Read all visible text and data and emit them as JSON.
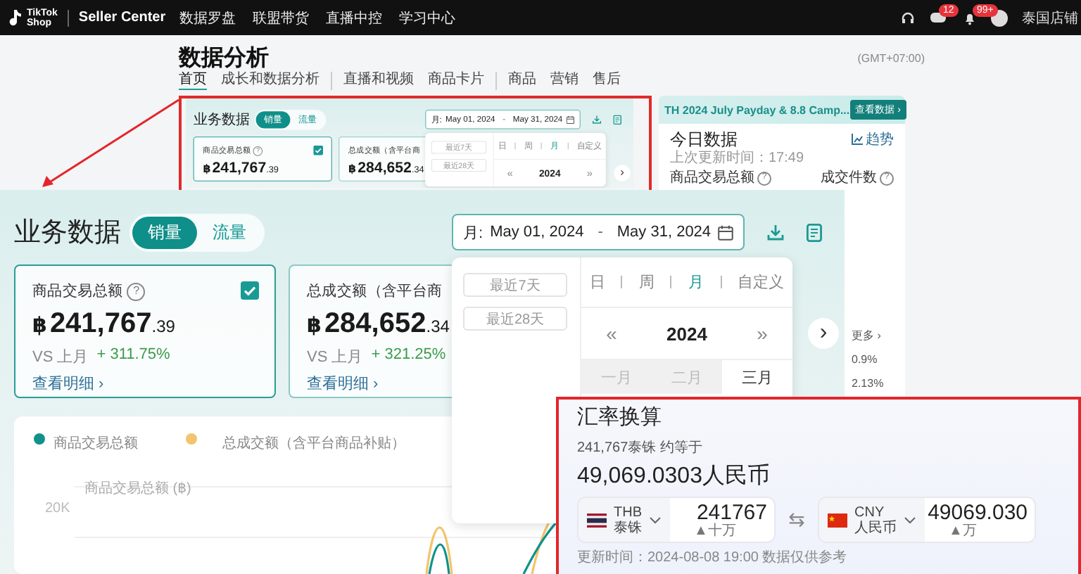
{
  "top_bar": {
    "logo_top": "TikTok",
    "logo_bottom": "Shop",
    "product": "Seller Center",
    "nav": [
      {
        "label": "数据罗盘"
      },
      {
        "label": "联盟带货"
      },
      {
        "label": "直播中控"
      },
      {
        "label": "学习中心"
      }
    ],
    "message_badge": "12",
    "notification_badge": "99+",
    "user": "泰国店铺"
  },
  "page": {
    "title": "数据分析",
    "timezone": "(GMT+07:00)",
    "tab_groups": [
      [
        {
          "label": "首页",
          "selected": true
        },
        {
          "label": "成长和数据分析",
          "selected": false
        }
      ],
      [
        {
          "label": "直播和视频",
          "selected": false
        },
        {
          "label": "商品卡片",
          "selected": false
        }
      ],
      [
        {
          "label": "商品",
          "selected": false
        },
        {
          "label": "营销",
          "selected": false
        },
        {
          "label": "售后",
          "selected": false
        }
      ]
    ]
  },
  "business_panel_preview": {
    "title": "业务数据",
    "toggle": [
      {
        "label": "销量",
        "selected": true
      },
      {
        "label": "流量",
        "selected": false
      }
    ],
    "date_range": {
      "prefix": "月:",
      "start": "May 01, 2024",
      "separator": "-",
      "end": "May 31, 2024"
    },
    "cards": [
      {
        "label": "商品交易总额",
        "help": "?",
        "checked": true,
        "currency": "฿",
        "value": "241,767",
        "decimals": ".39"
      },
      {
        "label": "总成交额（含平台商",
        "checked": false,
        "currency": "฿",
        "value": "284,652",
        "decimals": ".34"
      }
    ],
    "next": "›",
    "dropdown": {
      "quick": [
        "最近7天",
        "最近28天"
      ],
      "modes": [
        {
          "label": "日",
          "selected": false
        },
        {
          "label": "周",
          "selected": false
        },
        {
          "label": "月",
          "selected": true
        },
        {
          "label": "自定义",
          "selected": false
        }
      ],
      "prev": "«",
      "year": "2024",
      "next": "»"
    }
  },
  "today_card": {
    "banner": "TH 2024 July Payday & 8.8 Camp...",
    "banner_button": "查看数据 ›",
    "title": "今日数据",
    "trend": "趋势",
    "updated": "上次更新时间：17:49",
    "metrics": [
      {
        "label": "商品交易总额",
        "help": "?"
      },
      {
        "label": "成交件数",
        "help": "?"
      }
    ],
    "more": "更多 ›",
    "values": [
      "0.9%",
      "2.13%"
    ]
  },
  "business_panel_zoomed": {
    "title": "业务数据",
    "toggle": [
      {
        "label": "销量",
        "selected": true
      },
      {
        "label": "流量",
        "selected": false
      }
    ],
    "date_range": {
      "prefix": "月:",
      "start": "May 01, 2024",
      "separator": "-",
      "end": "May 31, 2024"
    },
    "cards": [
      {
        "label": "商品交易总额",
        "help": "?",
        "checked": true,
        "currency": "฿",
        "value": "241,767",
        "decimals": ".39",
        "compare": "VS 上月",
        "change": "+ 311.75%",
        "link": "查看明细 ›"
      },
      {
        "label": "总成交额（含平台商",
        "checked": false,
        "currency": "฿",
        "value": "284,652",
        "decimals": ".34",
        "compare": "VS 上月",
        "change": "+ 321.25%",
        "link": "查看明细 ›"
      }
    ],
    "next": "›",
    "dropdown": {
      "quick": [
        "最近7天",
        "最近28天"
      ],
      "modes": [
        {
          "label": "日",
          "selected": false
        },
        {
          "label": "周",
          "selected": false
        },
        {
          "label": "月",
          "selected": true
        },
        {
          "label": "自定义",
          "selected": false
        }
      ],
      "prev": "«",
      "year": "2024",
      "next": "»",
      "months": [
        {
          "label": "一月",
          "disabled": true
        },
        {
          "label": "二月",
          "disabled": true
        },
        {
          "label": "三月",
          "disabled": false
        }
      ]
    },
    "chart": {
      "legend": [
        {
          "label": "商品交易总额",
          "color": "#12918b"
        },
        {
          "label": "总成交额（含平台商品补贴）",
          "color": "#f2c46d"
        }
      ],
      "axis_title": "商品交易总额 (฿)",
      "y_labels": [
        "20K"
      ]
    }
  },
  "exchange": {
    "title": "汇率换算",
    "summary": "241,767泰铢 约等于",
    "result": "49,069.0303人民币",
    "from": {
      "kind": "thailand",
      "code": "THB",
      "name": "泰铢",
      "amount": "241767",
      "hint": "▲十万"
    },
    "swap": "⇆",
    "to": {
      "kind": "china",
      "code": "CNY",
      "name": "人民币",
      "amount": "49069.030",
      "hint": "▲万"
    },
    "footer": "更新时间：2024-08-08 19:00 数据仅供参考"
  }
}
